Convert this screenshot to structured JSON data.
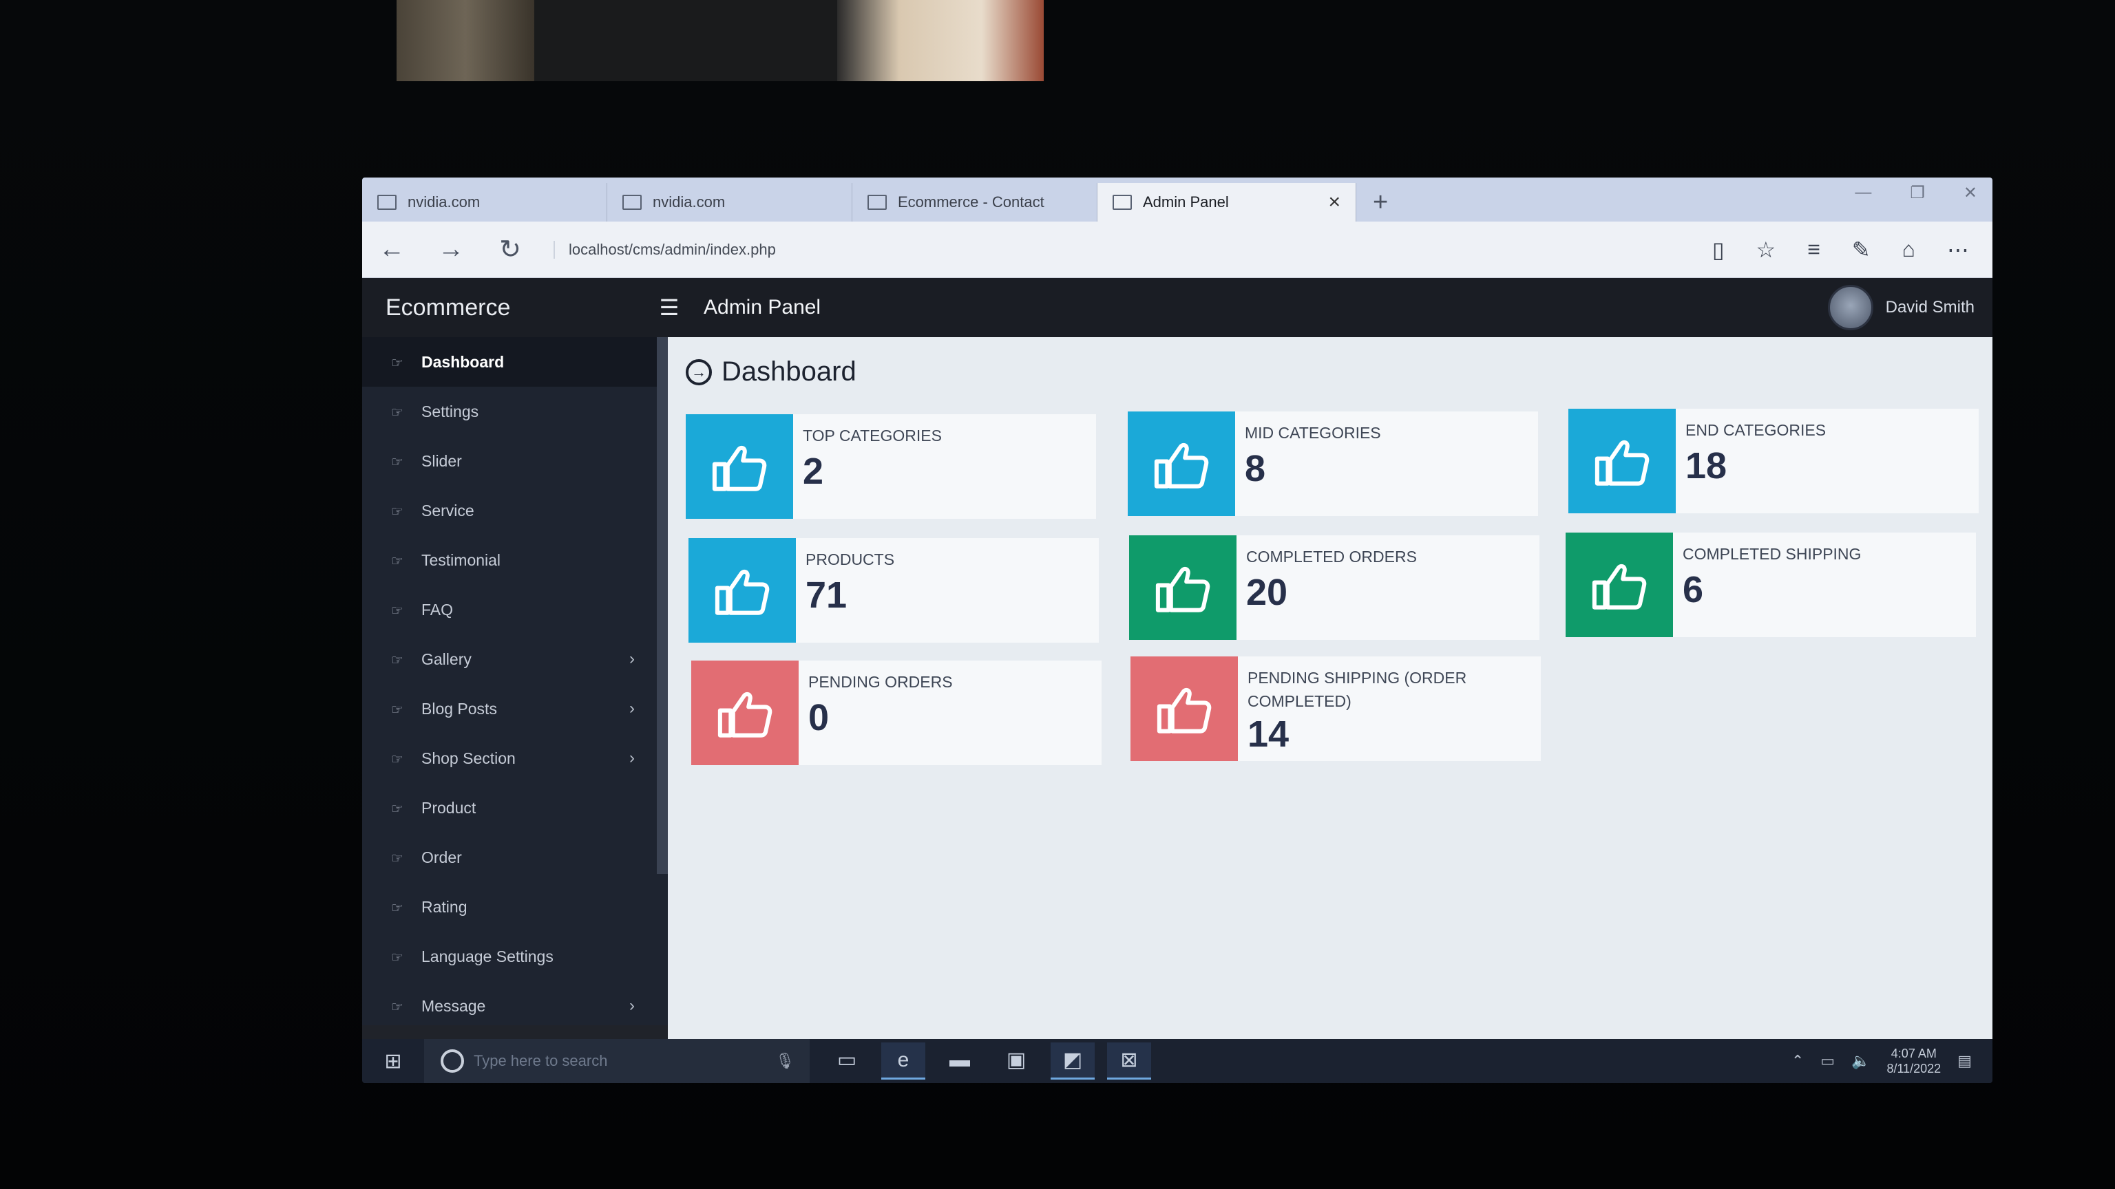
{
  "browser": {
    "tabs": [
      {
        "label": "nvidia.com",
        "active": false
      },
      {
        "label": "nvidia.com",
        "active": false
      },
      {
        "label": "Ecommerce - Contact",
        "active": false
      },
      {
        "label": "Admin Panel",
        "active": true
      }
    ],
    "close_tab_glyph": "×",
    "new_tab_glyph": "+",
    "url": "localhost/cms/admin/index.php"
  },
  "app": {
    "brand": "Ecommerce",
    "header_title": "Admin Panel",
    "user_name": "David Smith"
  },
  "sidebar": {
    "items": [
      {
        "label": "Dashboard",
        "active": true,
        "has_submenu": false
      },
      {
        "label": "Settings",
        "active": false,
        "has_submenu": false
      },
      {
        "label": "Slider",
        "active": false,
        "has_submenu": false
      },
      {
        "label": "Service",
        "active": false,
        "has_submenu": false
      },
      {
        "label": "Testimonial",
        "active": false,
        "has_submenu": false
      },
      {
        "label": "FAQ",
        "active": false,
        "has_submenu": false
      },
      {
        "label": "Gallery",
        "active": false,
        "has_submenu": true
      },
      {
        "label": "Blog Posts",
        "active": false,
        "has_submenu": true
      },
      {
        "label": "Shop Section",
        "active": false,
        "has_submenu": true
      },
      {
        "label": "Product",
        "active": false,
        "has_submenu": false
      },
      {
        "label": "Order",
        "active": false,
        "has_submenu": false
      },
      {
        "label": "Rating",
        "active": false,
        "has_submenu": false
      },
      {
        "label": "Language Settings",
        "active": false,
        "has_submenu": false
      },
      {
        "label": "Message",
        "active": false,
        "has_submenu": true
      }
    ]
  },
  "main": {
    "page_title": "Dashboard",
    "cards": [
      {
        "label": "TOP CATEGORIES",
        "value": "2",
        "color": "#1ba9d8"
      },
      {
        "label": "MID CATEGORIES",
        "value": "8",
        "color": "#1ba9d8"
      },
      {
        "label": "END CATEGORIES",
        "value": "18",
        "color": "#1ba9d8"
      },
      {
        "label": "PRODUCTS",
        "value": "71",
        "color": "#1ba9d8"
      },
      {
        "label": "COMPLETED ORDERS",
        "value": "20",
        "color": "#0f9b6a"
      },
      {
        "label": "COMPLETED SHIPPING",
        "value": "6",
        "color": "#0f9b6a"
      },
      {
        "label": "PENDING ORDERS",
        "value": "0",
        "color": "#e26d73"
      },
      {
        "label": "PENDING SHIPPING (ORDER COMPLETED)",
        "value": "14",
        "color": "#e26d73"
      }
    ],
    "card_icon": "thumbs-up-icon"
  },
  "taskbar": {
    "search_placeholder": "Type here to search",
    "time": "4:07 AM",
    "date": "8/11/2022"
  }
}
